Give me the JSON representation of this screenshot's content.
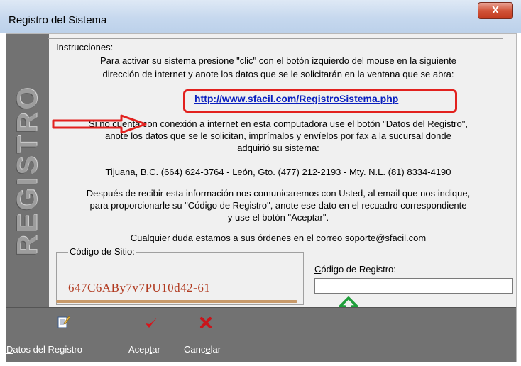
{
  "window": {
    "title": "Registro del Sistema",
    "close_label": "X"
  },
  "sidebar": {
    "text": "REGISTRO"
  },
  "instructions": {
    "legend": "Instrucciones:",
    "line1": "Para activar su sistema presione \"clic\" con el botón izquierdo del mouse en la siguiente",
    "line2": "dirección de internet y anote los datos que se le solicitarán en la ventana que se abra:",
    "link": "http://www.sfacil.com/RegistroSistema.php",
    "line3": "Si no cuenta con conexión a internet en esta computadora use el botón \"Datos del Registro\",",
    "line4": "anote los datos que se le solicitan, imprímalos y envíelos por fax a la sucursal donde",
    "line5": "adquirió su sistema:",
    "phones": "Tijuana, B.C. (664) 624-3764 - León, Gto. (477) 212-2193 - Mty. N.L. (81) 8334-4190",
    "line6": "Después de recibir esta información nos comunicaremos con Usted, al email que nos indique,",
    "line7": "para proporcionarle su \"Código de Registro\", anote ese dato en el recuadro correspondiente",
    "line8": "y use el botón \"Aceptar\".",
    "contact": "Cualquier duda estamos a sus órdenes en el correo soporte@sfacil.com"
  },
  "site": {
    "legend": "Código de Sitio:",
    "code": "647C6ABy7v7PU10d42-61"
  },
  "registration": {
    "label": "Código de Registro:",
    "value": ""
  },
  "toolbar": {
    "datos_label": "Datos del Registro",
    "aceptar_label": "Aceptar",
    "cancelar_label": "Cancelar",
    "datos_icon": "edit-document-icon",
    "aceptar_icon": "checkmark-icon",
    "cancelar_icon": "x-icon"
  },
  "colors": {
    "accent_red": "#e2211e",
    "accent_green": "#1e9e3a",
    "link_blue": "#0b1fbe"
  }
}
